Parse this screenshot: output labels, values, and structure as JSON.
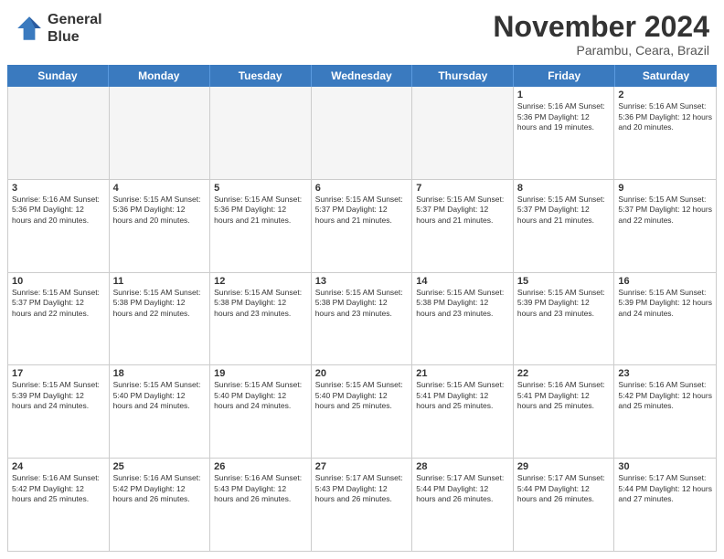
{
  "header": {
    "logo_line1": "General",
    "logo_line2": "Blue",
    "month": "November 2024",
    "location": "Parambu, Ceara, Brazil"
  },
  "weekdays": [
    "Sunday",
    "Monday",
    "Tuesday",
    "Wednesday",
    "Thursday",
    "Friday",
    "Saturday"
  ],
  "rows": [
    [
      {
        "day": "",
        "info": "",
        "empty": true
      },
      {
        "day": "",
        "info": "",
        "empty": true
      },
      {
        "day": "",
        "info": "",
        "empty": true
      },
      {
        "day": "",
        "info": "",
        "empty": true
      },
      {
        "day": "",
        "info": "",
        "empty": true
      },
      {
        "day": "1",
        "info": "Sunrise: 5:16 AM\nSunset: 5:36 PM\nDaylight: 12 hours and 19 minutes.",
        "empty": false
      },
      {
        "day": "2",
        "info": "Sunrise: 5:16 AM\nSunset: 5:36 PM\nDaylight: 12 hours and 20 minutes.",
        "empty": false
      }
    ],
    [
      {
        "day": "3",
        "info": "Sunrise: 5:16 AM\nSunset: 5:36 PM\nDaylight: 12 hours and 20 minutes.",
        "empty": false
      },
      {
        "day": "4",
        "info": "Sunrise: 5:15 AM\nSunset: 5:36 PM\nDaylight: 12 hours and 20 minutes.",
        "empty": false
      },
      {
        "day": "5",
        "info": "Sunrise: 5:15 AM\nSunset: 5:36 PM\nDaylight: 12 hours and 21 minutes.",
        "empty": false
      },
      {
        "day": "6",
        "info": "Sunrise: 5:15 AM\nSunset: 5:37 PM\nDaylight: 12 hours and 21 minutes.",
        "empty": false
      },
      {
        "day": "7",
        "info": "Sunrise: 5:15 AM\nSunset: 5:37 PM\nDaylight: 12 hours and 21 minutes.",
        "empty": false
      },
      {
        "day": "8",
        "info": "Sunrise: 5:15 AM\nSunset: 5:37 PM\nDaylight: 12 hours and 21 minutes.",
        "empty": false
      },
      {
        "day": "9",
        "info": "Sunrise: 5:15 AM\nSunset: 5:37 PM\nDaylight: 12 hours and 22 minutes.",
        "empty": false
      }
    ],
    [
      {
        "day": "10",
        "info": "Sunrise: 5:15 AM\nSunset: 5:37 PM\nDaylight: 12 hours and 22 minutes.",
        "empty": false
      },
      {
        "day": "11",
        "info": "Sunrise: 5:15 AM\nSunset: 5:38 PM\nDaylight: 12 hours and 22 minutes.",
        "empty": false
      },
      {
        "day": "12",
        "info": "Sunrise: 5:15 AM\nSunset: 5:38 PM\nDaylight: 12 hours and 23 minutes.",
        "empty": false
      },
      {
        "day": "13",
        "info": "Sunrise: 5:15 AM\nSunset: 5:38 PM\nDaylight: 12 hours and 23 minutes.",
        "empty": false
      },
      {
        "day": "14",
        "info": "Sunrise: 5:15 AM\nSunset: 5:38 PM\nDaylight: 12 hours and 23 minutes.",
        "empty": false
      },
      {
        "day": "15",
        "info": "Sunrise: 5:15 AM\nSunset: 5:39 PM\nDaylight: 12 hours and 23 minutes.",
        "empty": false
      },
      {
        "day": "16",
        "info": "Sunrise: 5:15 AM\nSunset: 5:39 PM\nDaylight: 12 hours and 24 minutes.",
        "empty": false
      }
    ],
    [
      {
        "day": "17",
        "info": "Sunrise: 5:15 AM\nSunset: 5:39 PM\nDaylight: 12 hours and 24 minutes.",
        "empty": false
      },
      {
        "day": "18",
        "info": "Sunrise: 5:15 AM\nSunset: 5:40 PM\nDaylight: 12 hours and 24 minutes.",
        "empty": false
      },
      {
        "day": "19",
        "info": "Sunrise: 5:15 AM\nSunset: 5:40 PM\nDaylight: 12 hours and 24 minutes.",
        "empty": false
      },
      {
        "day": "20",
        "info": "Sunrise: 5:15 AM\nSunset: 5:40 PM\nDaylight: 12 hours and 25 minutes.",
        "empty": false
      },
      {
        "day": "21",
        "info": "Sunrise: 5:15 AM\nSunset: 5:41 PM\nDaylight: 12 hours and 25 minutes.",
        "empty": false
      },
      {
        "day": "22",
        "info": "Sunrise: 5:16 AM\nSunset: 5:41 PM\nDaylight: 12 hours and 25 minutes.",
        "empty": false
      },
      {
        "day": "23",
        "info": "Sunrise: 5:16 AM\nSunset: 5:42 PM\nDaylight: 12 hours and 25 minutes.",
        "empty": false
      }
    ],
    [
      {
        "day": "24",
        "info": "Sunrise: 5:16 AM\nSunset: 5:42 PM\nDaylight: 12 hours and 25 minutes.",
        "empty": false
      },
      {
        "day": "25",
        "info": "Sunrise: 5:16 AM\nSunset: 5:42 PM\nDaylight: 12 hours and 26 minutes.",
        "empty": false
      },
      {
        "day": "26",
        "info": "Sunrise: 5:16 AM\nSunset: 5:43 PM\nDaylight: 12 hours and 26 minutes.",
        "empty": false
      },
      {
        "day": "27",
        "info": "Sunrise: 5:17 AM\nSunset: 5:43 PM\nDaylight: 12 hours and 26 minutes.",
        "empty": false
      },
      {
        "day": "28",
        "info": "Sunrise: 5:17 AM\nSunset: 5:44 PM\nDaylight: 12 hours and 26 minutes.",
        "empty": false
      },
      {
        "day": "29",
        "info": "Sunrise: 5:17 AM\nSunset: 5:44 PM\nDaylight: 12 hours and 26 minutes.",
        "empty": false
      },
      {
        "day": "30",
        "info": "Sunrise: 5:17 AM\nSunset: 5:44 PM\nDaylight: 12 hours and 27 minutes.",
        "empty": false
      }
    ]
  ]
}
